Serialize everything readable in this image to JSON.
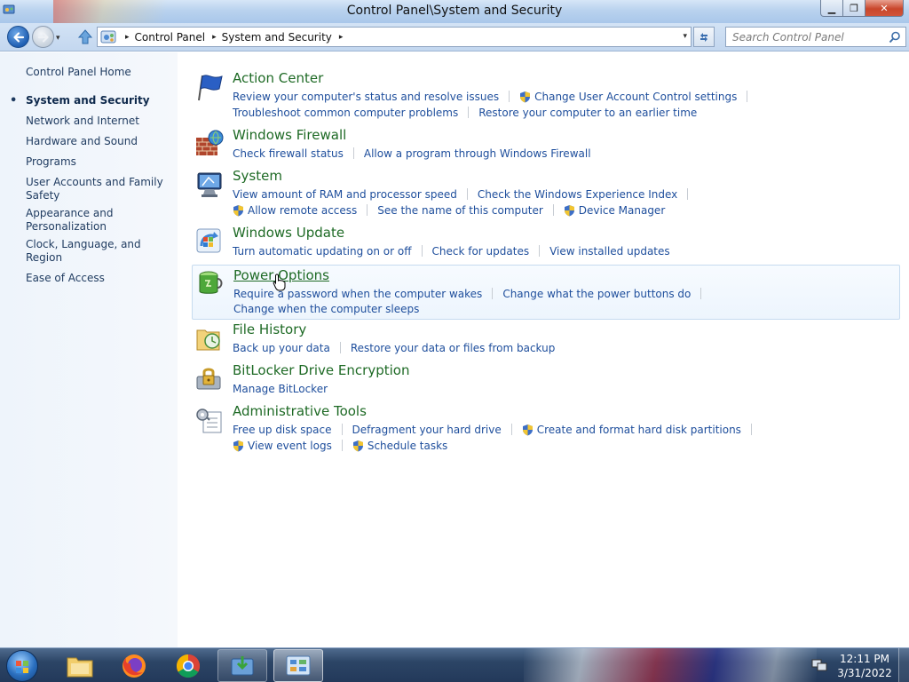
{
  "window": {
    "title": "Control Panel\\System and Security",
    "minimize_glyph": "▁",
    "maximize_glyph": "❐",
    "close_glyph": "✕"
  },
  "navbar": {
    "breadcrumbs": [
      "Control Panel",
      "System and Security"
    ],
    "crumb_separator": "▸",
    "dropdown_glyph": "▾",
    "search_placeholder": "Search Control Panel"
  },
  "sidebar": {
    "home": "Control Panel Home",
    "items": [
      {
        "label": "System and Security",
        "current": true
      },
      {
        "label": "Network and Internet"
      },
      {
        "label": "Hardware and Sound"
      },
      {
        "label": "Programs"
      },
      {
        "label": "User Accounts and Family Safety"
      },
      {
        "label": "Appearance and Personalization"
      },
      {
        "label": "Clock, Language, and Region"
      },
      {
        "label": "Ease of Access"
      }
    ]
  },
  "categories": [
    {
      "title": "Action Center",
      "icon": "flag-icon",
      "rows": [
        [
          {
            "label": "Review your computer's status and resolve issues"
          },
          {
            "label": "Change User Account Control settings",
            "shield": true
          }
        ],
        [
          {
            "label": "Troubleshoot common computer problems"
          },
          {
            "label": "Restore your computer to an earlier time"
          }
        ]
      ]
    },
    {
      "title": "Windows Firewall",
      "icon": "firewall-icon",
      "rows": [
        [
          {
            "label": "Check firewall status"
          },
          {
            "label": "Allow a program through Windows Firewall"
          }
        ]
      ]
    },
    {
      "title": "System",
      "icon": "computer-icon",
      "rows": [
        [
          {
            "label": "View amount of RAM and processor speed"
          },
          {
            "label": "Check the Windows Experience Index"
          }
        ],
        [
          {
            "label": "Allow remote access",
            "shield": true
          },
          {
            "label": "See the name of this computer"
          },
          {
            "label": "Device Manager",
            "shield": true
          }
        ]
      ]
    },
    {
      "title": "Windows Update",
      "icon": "windows-update-icon",
      "rows": [
        [
          {
            "label": "Turn automatic updating on or off"
          },
          {
            "label": "Check for updates"
          },
          {
            "label": "View installed updates"
          }
        ]
      ]
    },
    {
      "title": "Power Options",
      "icon": "battery-icon",
      "hover": true,
      "rows": [
        [
          {
            "label": "Require a password when the computer wakes"
          },
          {
            "label": "Change what the power buttons do"
          }
        ],
        [
          {
            "label": "Change when the computer sleeps"
          }
        ]
      ]
    },
    {
      "title": "File History",
      "icon": "file-history-icon",
      "rows": [
        [
          {
            "label": "Back up your data"
          },
          {
            "label": "Restore your data or files from backup"
          }
        ]
      ]
    },
    {
      "title": "BitLocker Drive Encryption",
      "icon": "bitlocker-icon",
      "rows": [
        [
          {
            "label": "Manage BitLocker"
          }
        ]
      ]
    },
    {
      "title": "Administrative Tools",
      "icon": "admin-tools-icon",
      "rows": [
        [
          {
            "label": "Free up disk space"
          },
          {
            "label": "Defragment your hard drive"
          },
          {
            "label": "Create and format hard disk partitions",
            "shield": true
          }
        ],
        [
          {
            "label": "View event logs",
            "shield": true
          },
          {
            "label": "Schedule tasks",
            "shield": true
          }
        ]
      ]
    }
  ],
  "taskbar": {
    "items": [
      {
        "name": "explorer-icon",
        "state": "pinned"
      },
      {
        "name": "firefox-icon",
        "state": "pinned"
      },
      {
        "name": "chrome-icon",
        "state": "pinned"
      },
      {
        "name": "installer-icon",
        "state": "open"
      },
      {
        "name": "control-panel-icon",
        "state": "active"
      }
    ],
    "time": "12:11 PM",
    "date": "3/31/2022"
  },
  "colors": {
    "category_title": "#1e6a25",
    "task_link": "#1e4e9c",
    "sidebar_link": "#1e3a5f"
  }
}
